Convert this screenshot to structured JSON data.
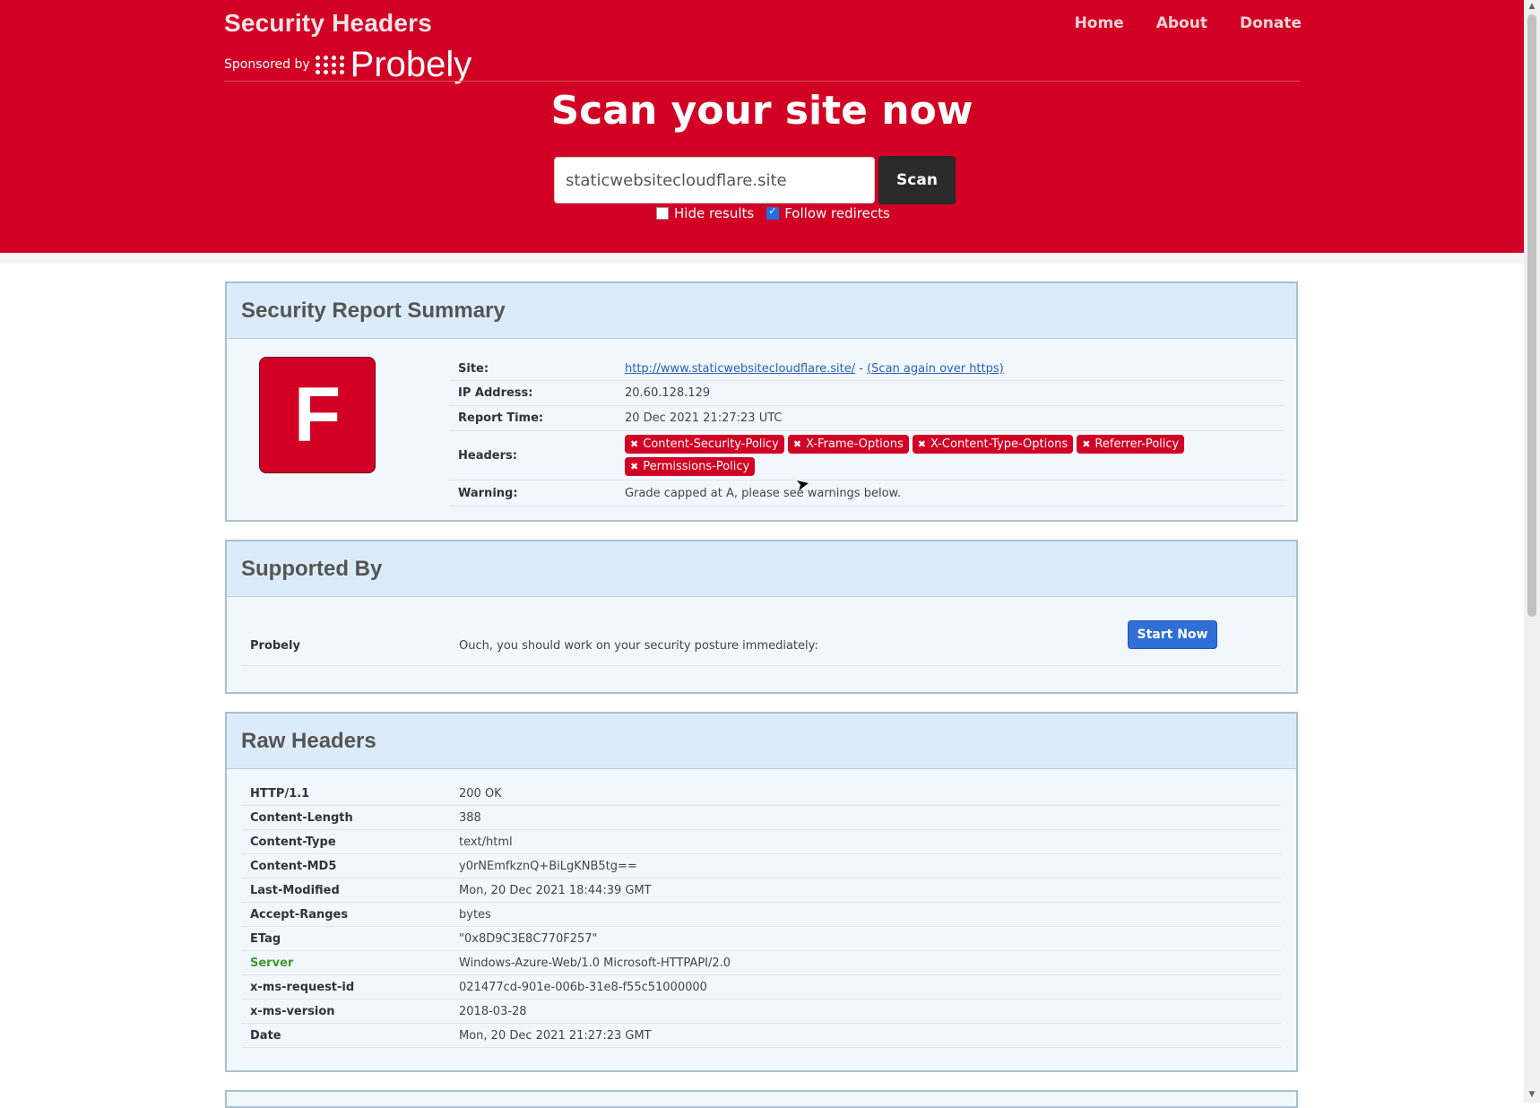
{
  "header": {
    "brand_title": "Security Headers",
    "sponsored_by": "Sponsored by",
    "sponsor_name": "Probely",
    "nav": [
      "Home",
      "About",
      "Donate"
    ],
    "hero_title": "Scan your site now",
    "scan_input_value": "staticwebsitecloudflare.site",
    "scan_button": "Scan",
    "hide_results_label": "Hide results",
    "hide_results_checked": false,
    "follow_redirects_label": "Follow redirects",
    "follow_redirects_checked": true
  },
  "summary": {
    "title": "Security Report Summary",
    "grade": "F",
    "site_label": "Site:",
    "site_url": "http://www.staticwebsitecloudflare.site/",
    "site_sep": " - ",
    "scan_again": "(Scan again over https)",
    "ip_label": "IP Address:",
    "ip": "20.60.128.129",
    "time_label": "Report Time:",
    "time": "20 Dec 2021 21:27:23 UTC",
    "headers_label": "Headers:",
    "missing_headers": [
      "Content-Security-Policy",
      "X-Frame-Options",
      "X-Content-Type-Options",
      "Referrer-Policy",
      "Permissions-Policy"
    ],
    "warning_label": "Warning:",
    "warning": "Grade capped at A, please see warnings below."
  },
  "supported": {
    "title": "Supported By",
    "name": "Probely",
    "text": "Ouch, you should work on your security posture immediately:",
    "button": "Start Now"
  },
  "raw": {
    "title": "Raw Headers",
    "rows": [
      {
        "k": "HTTP/1.1",
        "v": "200 OK"
      },
      {
        "k": "Content-Length",
        "v": "388"
      },
      {
        "k": "Content-Type",
        "v": "text/html"
      },
      {
        "k": "Content-MD5",
        "v": "y0rNEmfkznQ+BiLgKNB5tg=="
      },
      {
        "k": "Last-Modified",
        "v": "Mon, 20 Dec 2021 18:44:39 GMT"
      },
      {
        "k": "Accept-Ranges",
        "v": "bytes"
      },
      {
        "k": "ETag",
        "v": "\"0x8D9C3E8C770F257\""
      },
      {
        "k": "Server",
        "v": "Windows-Azure-Web/1.0 Microsoft-HTTPAPI/2.0"
      },
      {
        "k": "x-ms-request-id",
        "v": "021477cd-901e-006b-31e8-f55c51000000"
      },
      {
        "k": "x-ms-version",
        "v": "2018-03-28"
      },
      {
        "k": "Date",
        "v": "Mon, 20 Dec 2021 21:27:23 GMT"
      }
    ]
  },
  "colors": {
    "brand_red": "#d20024",
    "link_blue": "#2b62b8",
    "server_green": "#3f9a2f",
    "button_blue": "#2f6fd6"
  }
}
